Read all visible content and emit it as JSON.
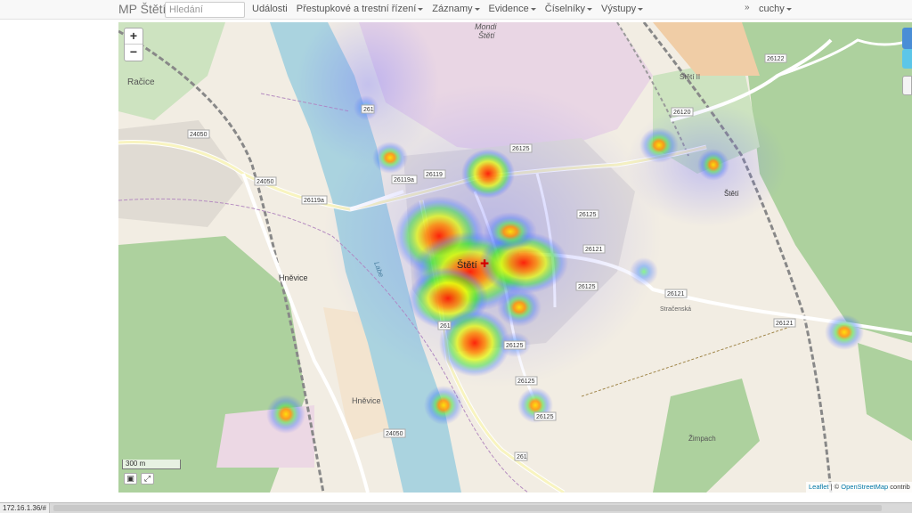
{
  "navbar": {
    "brand": "MP Štětí",
    "search_placeholder": "Hledání",
    "menu": [
      {
        "label": "Události",
        "dropdown": false
      },
      {
        "label": "Přestupkové a trestní řízení",
        "dropdown": true
      },
      {
        "label": "Záznamy",
        "dropdown": true
      },
      {
        "label": "Evidence",
        "dropdown": true
      },
      {
        "label": "Číselníky",
        "dropdown": true
      },
      {
        "label": "Výstupy",
        "dropdown": true
      }
    ],
    "collapse_glyph": "»",
    "user": "cuchy"
  },
  "map": {
    "zoom_in": "+",
    "zoom_out": "−",
    "scale": "300 m",
    "attribution_leaflet": "Leaflet",
    "attribution_sep": " | © ",
    "attribution_osm": "OpenStreetMap",
    "attribution_rest": " contrib",
    "places": [
      {
        "id": "mondi",
        "text": "Mondi"
      },
      {
        "id": "steti-top",
        "text": "Štětí"
      },
      {
        "id": "racice",
        "text": "Račice"
      },
      {
        "id": "steti-center",
        "text": "Štětí"
      },
      {
        "id": "hnevice",
        "text": "Hněvice"
      },
      {
        "id": "hnevice2",
        "text": "Hněvice"
      },
      {
        "id": "steti-ii",
        "text": "Štětí II"
      },
      {
        "id": "steti-east",
        "text": "Štětí"
      },
      {
        "id": "stracenska",
        "text": "Stračenská"
      },
      {
        "id": "zimpach",
        "text": "Žimpach"
      },
      {
        "id": "labe",
        "text": "Labe"
      }
    ],
    "road_numbers": [
      "261",
      "24050",
      "24050",
      "26119a",
      "26119",
      "26119a",
      "26125",
      "26125",
      "26125",
      "26125",
      "26121",
      "26121",
      "26121",
      "26120",
      "26122",
      "261",
      "24050",
      "261",
      "26125",
      "26125"
    ],
    "hotspots": [
      {
        "lat_label": "center-main",
        "intensity": 1.0
      },
      {
        "lat_label": "north",
        "intensity": 0.8
      },
      {
        "lat_label": "south",
        "intensity": 0.85
      },
      {
        "lat_label": "east-stack",
        "intensity": 0.7
      }
    ]
  },
  "statusbar": {
    "url": "172.16.1.36/#"
  }
}
